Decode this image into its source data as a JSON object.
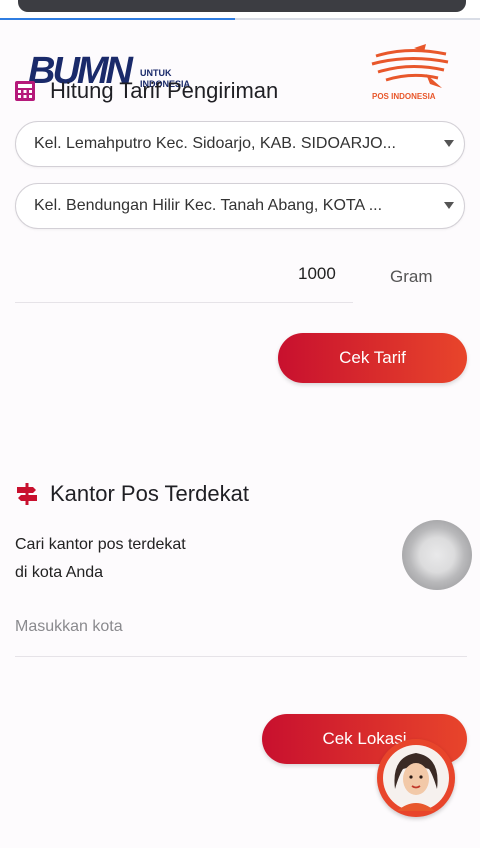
{
  "browser": {
    "progress": 0.49
  },
  "brand": {
    "bumn_logo_text": "BUMN",
    "bumn_sub_line1": "UNTUK",
    "bumn_sub_line2": "INDONESIA",
    "pos_logo_text": "POS INDONESIA",
    "accent_color": "#c8102e",
    "accent_color_2": "#e8452b"
  },
  "tariff": {
    "title": "Hitung Tarif Pengiriman",
    "origin_value": "Kel. Lemahputro Kec. Sidoarjo, KAB. SIDOARJO...",
    "destination_value": "Kel. Bendungan Hilir Kec. Tanah Abang, KOTA ...",
    "weight_value": "1000",
    "weight_unit": "Gram",
    "check_button": "Cek Tarif"
  },
  "post_office": {
    "title": "Kantor Pos Terdekat",
    "description_line1": "Cari kantor pos terdekat",
    "description_line2": "di kota Anda",
    "city_placeholder": "Masukkan kota",
    "check_button": "Cek Lokasi"
  },
  "icons": {
    "calculator": "calculator-icon",
    "signpost": "signpost-icon",
    "dropdown": "chevron-down-icon",
    "chat_avatar": "assistant-avatar-icon"
  }
}
